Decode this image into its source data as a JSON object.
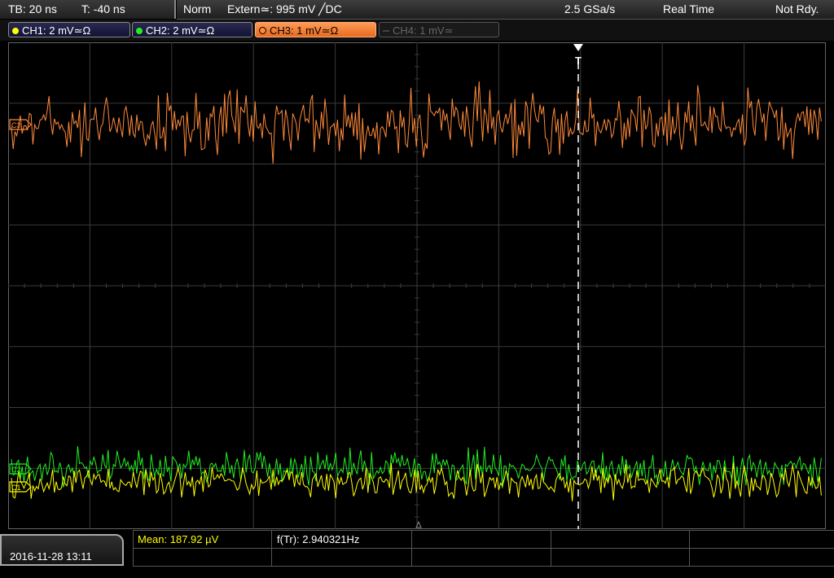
{
  "status_bar": {
    "timebase": "TB: 20 ns",
    "trigger_time": "T: -40 ns",
    "trigger_mode": "Norm",
    "trigger_source": "Extern≃: 995 mV ╱DC",
    "sample_rate": "2.5 GSa/s",
    "acq_mode": "Real Time",
    "state": "Not Rdy."
  },
  "channels": [
    {
      "label": "CH1: 2 mV≃Ω",
      "color": "#ffff00",
      "state": "on"
    },
    {
      "label": "CH2: 2 mV≃Ω",
      "color": "#22ee22",
      "state": "on"
    },
    {
      "label": "CH3: 1 mV≃Ω",
      "color": "#ff8a3a",
      "state": "active"
    },
    {
      "label": "CH4: 1 mV≃",
      "color": "#666666",
      "state": "off"
    }
  ],
  "markers": {
    "ch3": "C3",
    "ch2": "C2",
    "ch1": "C1",
    "trigger": "T"
  },
  "colors": {
    "ch1": "#ffff00",
    "ch2": "#22ee22",
    "ch3": "#ff8a3a",
    "grid": "#3a3a3a"
  },
  "footer": {
    "datetime": "2016-11-28 13:11",
    "mean": "Mean: 187.92 µV",
    "freq": "f(Tr): 2.940321Hz"
  }
}
